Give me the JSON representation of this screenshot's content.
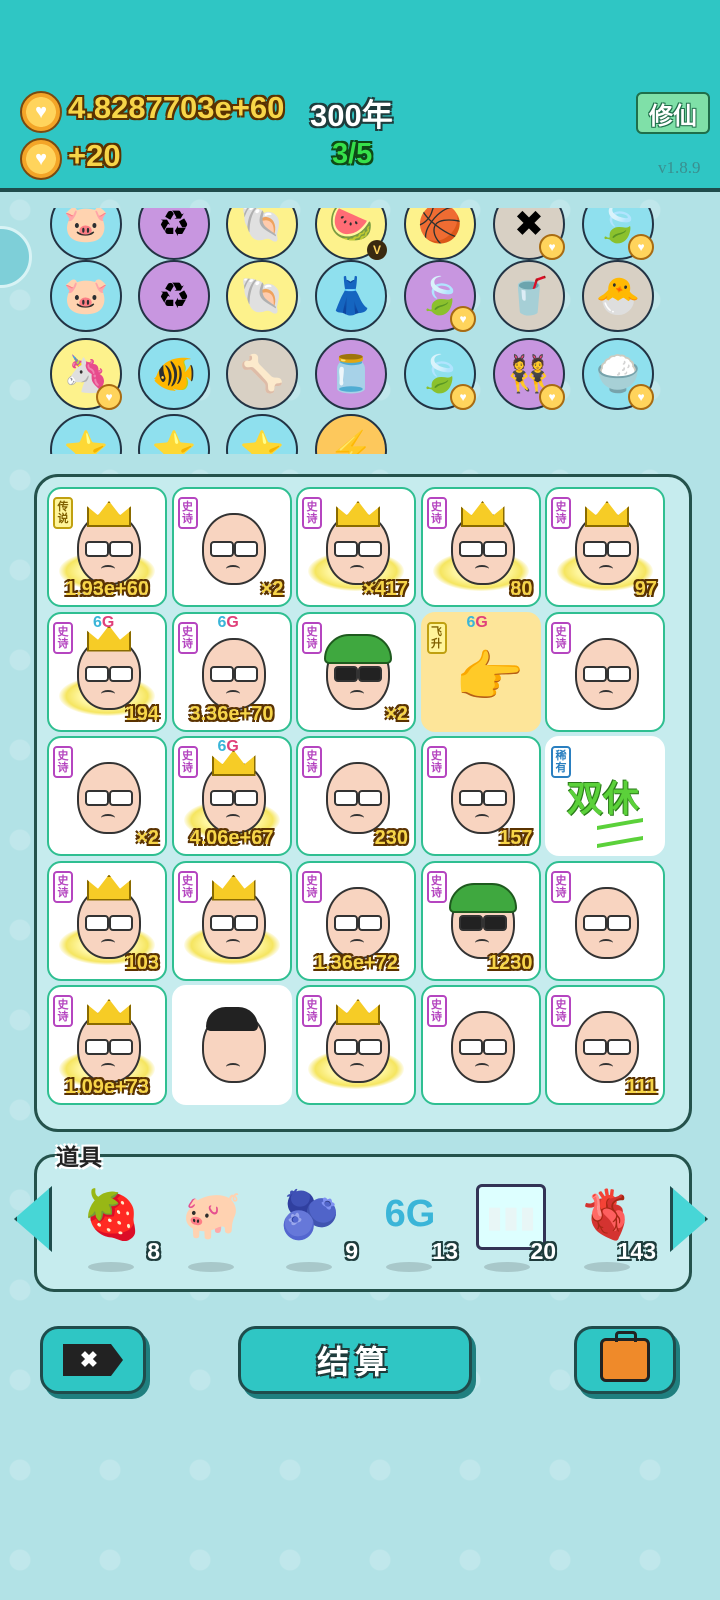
{
  "header": {
    "gold_total": "4.8287703e+60",
    "years": "300年",
    "gold_rate": "+20",
    "progress": "3/5",
    "cultivate_button": "修仙",
    "version": "v1.8.9"
  },
  "collection": [
    {
      "row": 0,
      "col": 0,
      "icon": "piggy-bank-icon",
      "glyph": "🐷",
      "bg": "#8fe0ee"
    },
    {
      "row": 0,
      "col": 1,
      "icon": "recycle-icon",
      "glyph": "♻",
      "bg": "#c896e0"
    },
    {
      "row": 0,
      "col": 2,
      "icon": "shell-icon",
      "glyph": "🐚",
      "bg": "#fdf28c"
    },
    {
      "row": 0,
      "col": 3,
      "icon": "fruit-basket-icon",
      "glyph": "🍉",
      "bg": "#fdf28c",
      "badge": "V"
    },
    {
      "row": 0,
      "col": 4,
      "icon": "basketballs-icon",
      "glyph": "🏀",
      "bg": "#fdf28c"
    },
    {
      "row": 0,
      "col": 5,
      "icon": "close-tag-icon",
      "glyph": "✖",
      "bg": "#d8d0c4",
      "badge": "heart"
    },
    {
      "row": 0,
      "col": 6,
      "icon": "leaf-icon",
      "glyph": "🍃",
      "bg": "#8fe0ee",
      "badge": "heart"
    },
    {
      "row": 1,
      "col": 0,
      "icon": "piggy-bank-icon",
      "glyph": "🐷",
      "bg": "#8fe0ee"
    },
    {
      "row": 1,
      "col": 1,
      "icon": "recycle-icon",
      "glyph": "♻",
      "bg": "#c896e0"
    },
    {
      "row": 1,
      "col": 2,
      "icon": "shell-icon",
      "glyph": "🐚",
      "bg": "#fdf28c"
    },
    {
      "row": 1,
      "col": 3,
      "icon": "skirt-icon",
      "glyph": "👗",
      "bg": "#8fe0ee"
    },
    {
      "row": 1,
      "col": 4,
      "icon": "leaf-icon",
      "glyph": "🍃",
      "bg": "#c896e0",
      "badge": "heart"
    },
    {
      "row": 1,
      "col": 5,
      "icon": "bubble-tea-icon",
      "glyph": "🥤",
      "bg": "#d8d0c4"
    },
    {
      "row": 1,
      "col": 6,
      "icon": "chick-egg-icon",
      "glyph": "🐣",
      "bg": "#d8d0c4"
    },
    {
      "row": 2,
      "col": 0,
      "icon": "unicorn-icon",
      "glyph": "🦄",
      "bg": "#fdf28c",
      "badge": "heart"
    },
    {
      "row": 2,
      "col": 1,
      "icon": "fish-tank-icon",
      "glyph": "🐠",
      "bg": "#8fe0ee"
    },
    {
      "row": 2,
      "col": 2,
      "icon": "dog-food-icon",
      "glyph": "🦴",
      "bg": "#d8d0c4"
    },
    {
      "row": 2,
      "col": 3,
      "icon": "jar-icon",
      "glyph": "🫙",
      "bg": "#c896e0"
    },
    {
      "row": 2,
      "col": 4,
      "icon": "leaf-icon",
      "glyph": "🍃",
      "bg": "#8fe0ee",
      "badge": "heart"
    },
    {
      "row": 2,
      "col": 5,
      "icon": "twins-icon",
      "glyph": "👯",
      "bg": "#c896e0",
      "badge": "heart"
    },
    {
      "row": 2,
      "col": 6,
      "icon": "rice-bowl-icon",
      "glyph": "🍚",
      "bg": "#8fe0ee",
      "badge": "heart"
    },
    {
      "row": 3,
      "col": 0,
      "icon": "star-icon",
      "glyph": "⭐",
      "bg": "#8fe0ee"
    },
    {
      "row": 3,
      "col": 1,
      "icon": "star-icon",
      "glyph": "⭐",
      "bg": "#8fe0ee"
    },
    {
      "row": 3,
      "col": 2,
      "icon": "star-icon",
      "glyph": "⭐",
      "bg": "#8fe0ee"
    },
    {
      "row": 3,
      "col": 3,
      "icon": "lightning-icon",
      "glyph": "⚡",
      "bg": "#fdc85c"
    }
  ],
  "board": [
    {
      "tag": "传说",
      "tag_style": "gold",
      "avatar": "crown-grin",
      "value": "1.93e+60",
      "center": true,
      "glow": true
    },
    {
      "tag": "史诗",
      "avatar": "plain",
      "value": "×2"
    },
    {
      "tag": "史诗",
      "avatar": "crown",
      "value": "×417",
      "glow": true
    },
    {
      "tag": "史诗",
      "avatar": "crown",
      "value": "80",
      "glow": true
    },
    {
      "tag": "史诗",
      "avatar": "crown",
      "value": "97",
      "glow": true
    },
    {
      "tag": "史诗",
      "avatar": "crown",
      "value": "194",
      "sixg": true,
      "glow": true
    },
    {
      "tag": "史诗",
      "avatar": "plain",
      "value": "3.36e+70",
      "center": true,
      "sixg": true
    },
    {
      "tag": "史诗",
      "avatar": "green-hat",
      "value": "×2"
    },
    {
      "tag": "飞升",
      "tag_style": "gold",
      "avatar": "hand",
      "value": "",
      "sixg": true,
      "yellow": true
    },
    {
      "tag": "史诗",
      "avatar": "plain",
      "value": ""
    },
    {
      "tag": "史诗",
      "avatar": "plain",
      "value": "×2"
    },
    {
      "tag": "史诗",
      "avatar": "crown",
      "value": "4.06e+67",
      "center": true,
      "sixg": true,
      "glow": true
    },
    {
      "tag": "史诗",
      "avatar": "plain",
      "value": "230"
    },
    {
      "tag": "史诗",
      "avatar": "plain",
      "value": "157"
    },
    {
      "tag": "稀有",
      "tag_style": "blue",
      "avatar": "shuangxiu",
      "text": "双休",
      "value": "",
      "borderless": true
    },
    {
      "tag": "史诗",
      "avatar": "crown",
      "value": "103",
      "glow": true
    },
    {
      "tag": "史诗",
      "avatar": "crown",
      "value": "",
      "glow": true
    },
    {
      "tag": "史诗",
      "avatar": "plain",
      "value": "1.36e+72",
      "center": true
    },
    {
      "tag": "史诗",
      "avatar": "green-hat",
      "value": "1230"
    },
    {
      "tag": "史诗",
      "avatar": "plain",
      "value": ""
    },
    {
      "tag": "史诗",
      "avatar": "crown",
      "value": "1.09e+73",
      "center": true,
      "glow": true
    },
    {
      "tag": "",
      "avatar": "young",
      "value": "",
      "borderless": true
    },
    {
      "tag": "史诗",
      "avatar": "crown",
      "value": "",
      "glow": true
    },
    {
      "tag": "史诗",
      "avatar": "plain",
      "value": ""
    },
    {
      "tag": "史诗",
      "avatar": "plain",
      "value": "111"
    }
  ],
  "items": {
    "title": "道具",
    "list": [
      {
        "icon": "strawberry-icon",
        "glyph": "🍓",
        "count": "8"
      },
      {
        "icon": "piggy-bank-icon",
        "glyph": "🐖",
        "count": ""
      },
      {
        "icon": "blueberry-icon",
        "glyph": "🫐",
        "count": "9"
      },
      {
        "icon": "6g-icon",
        "glyph": "6G",
        "count": "13"
      },
      {
        "icon": "battery-icon",
        "glyph": "▮▮▮",
        "count": "20"
      },
      {
        "icon": "liver-icon",
        "glyph": "🫀",
        "count": "143"
      }
    ]
  },
  "buttons": {
    "settle": "结算"
  },
  "colors": {
    "header": "#2fc6c4",
    "background": "#b2e2e6",
    "value_gold": "#f7d548",
    "epic_purple": "#b545c0",
    "cell_border": "#2fbf91"
  }
}
